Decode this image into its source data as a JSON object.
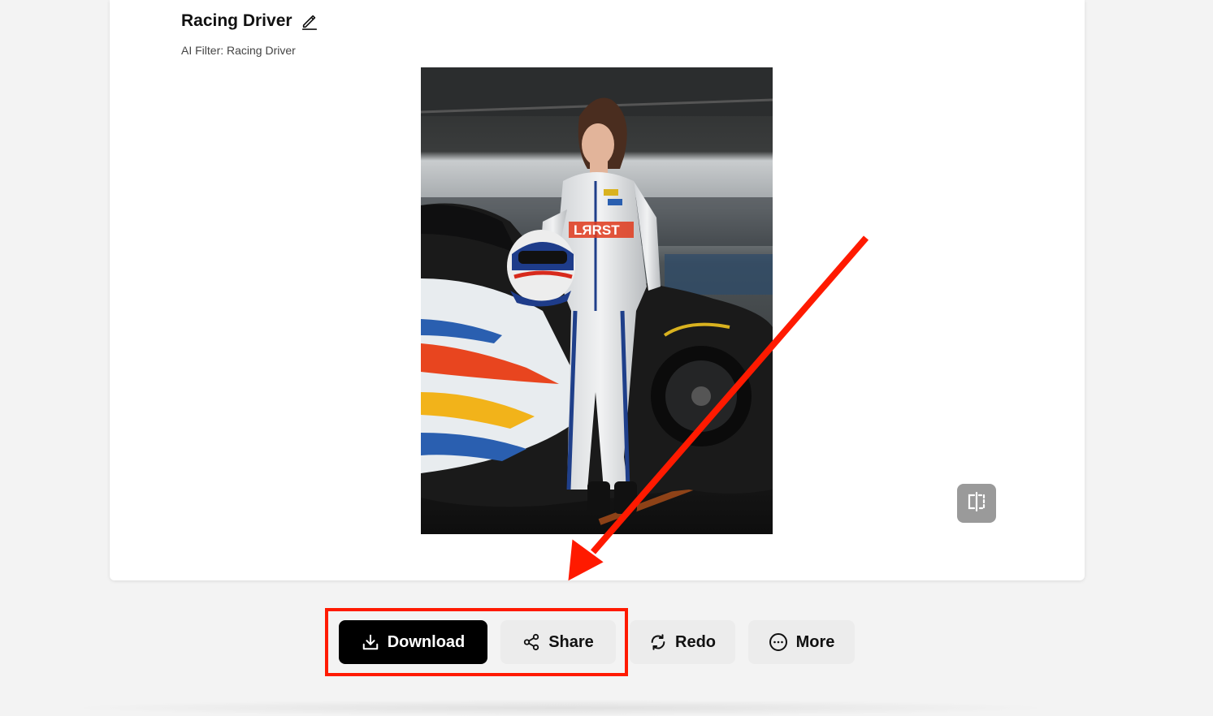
{
  "header": {
    "title": "Racing Driver",
    "subtitle": "AI Filter: Racing Driver"
  },
  "image": {
    "alt": "AI generated portrait of a racing driver in a white race suit holding a helmet next to a race car",
    "suit_text": "LЯRST"
  },
  "icons": {
    "edit": "pencil-icon",
    "compare": "compare-icon",
    "download": "download-icon",
    "share": "share-icon",
    "redo": "redo-icon",
    "more": "more-icon"
  },
  "actions": {
    "download_label": "Download",
    "share_label": "Share",
    "redo_label": "Redo",
    "more_label": "More"
  },
  "annotation": {
    "color": "#ff1a00"
  }
}
